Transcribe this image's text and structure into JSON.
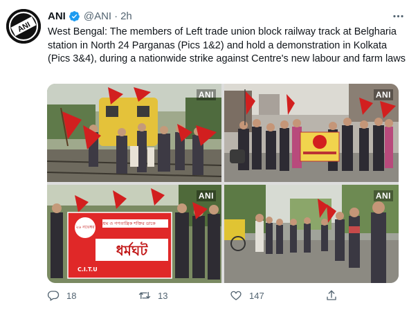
{
  "tweet": {
    "display_name": "ANI",
    "handle": "@ANI",
    "dot": "·",
    "timestamp": "2h",
    "verified_icon": "verified-badge-icon",
    "text": "West Bengal: The members of Left trade union block railway track at Belgharia station in North 24 Parganas (Pics 1&2) and hold a demonstration in Kolkata (Pics 3&4), during a nationwide strike against Centre's new labour and farm laws",
    "watermark": "ANI",
    "banner_text_top": "শ্রম ও গণতান্ত্রিক শক্তির ডাকে",
    "banner_text_main": "ধর্মঘট",
    "banner_badge": "২৬ নভেম্বর",
    "banner_footer": "C.I.T.U",
    "actions": {
      "reply_count": "18",
      "retweet_count": "13",
      "like_count": "147"
    }
  },
  "colors": {
    "accent": "#1d9bf0",
    "text": "#0f1419",
    "muted": "#536471",
    "flag_red": "#d21f1f"
  }
}
